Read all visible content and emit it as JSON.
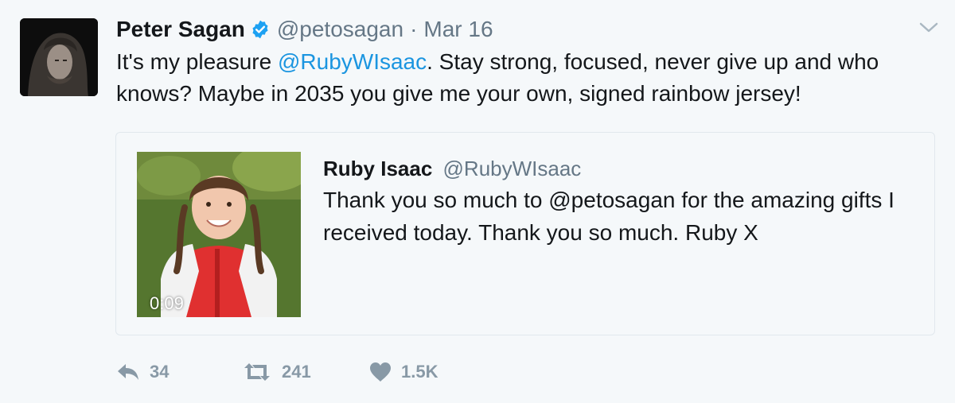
{
  "tweet": {
    "display_name": "Peter Sagan",
    "handle": "@petosagan",
    "separator": "·",
    "date": "Mar 16",
    "text_before_mention": "It's my pleasure ",
    "mention": "@RubyWIsaac",
    "text_after_mention": ". Stay strong, focused, never give up and who knows? Maybe in 2035 you give me your own, signed rainbow jersey!",
    "verified_icon": "verified-badge-icon",
    "menu_icon": "chevron-down-icon"
  },
  "quoted_tweet": {
    "display_name": "Ruby Isaac",
    "handle": "@RubyWIsaac",
    "text": "Thank you so much to @petosagan for the amazing gifts I received today. Thank you so much. Ruby X",
    "video_duration": "0:09"
  },
  "actions": {
    "reply_count": "34",
    "retweet_count": "241",
    "like_count": "1.5K"
  },
  "colors": {
    "background": "#f5f8fa",
    "link": "#1b95e0",
    "secondary_text": "#657786",
    "action_icon": "#8899a6",
    "verified": "#1da1f2"
  }
}
